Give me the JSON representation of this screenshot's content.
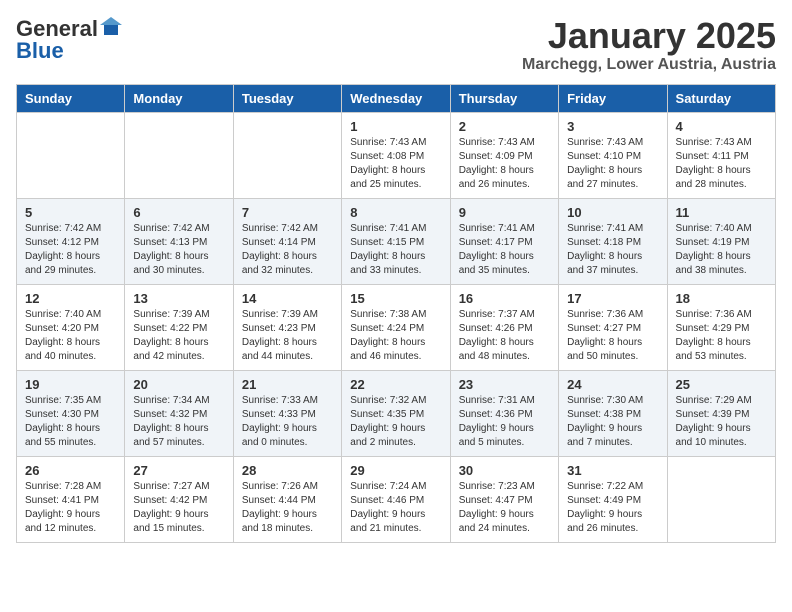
{
  "logo": {
    "general": "General",
    "blue": "Blue"
  },
  "title": "January 2025",
  "location": "Marchegg, Lower Austria, Austria",
  "days_of_week": [
    "Sunday",
    "Monday",
    "Tuesday",
    "Wednesday",
    "Thursday",
    "Friday",
    "Saturday"
  ],
  "weeks": [
    {
      "days": [
        {
          "number": "",
          "info": ""
        },
        {
          "number": "",
          "info": ""
        },
        {
          "number": "",
          "info": ""
        },
        {
          "number": "1",
          "info": "Sunrise: 7:43 AM\nSunset: 4:08 PM\nDaylight: 8 hours and 25 minutes."
        },
        {
          "number": "2",
          "info": "Sunrise: 7:43 AM\nSunset: 4:09 PM\nDaylight: 8 hours and 26 minutes."
        },
        {
          "number": "3",
          "info": "Sunrise: 7:43 AM\nSunset: 4:10 PM\nDaylight: 8 hours and 27 minutes."
        },
        {
          "number": "4",
          "info": "Sunrise: 7:43 AM\nSunset: 4:11 PM\nDaylight: 8 hours and 28 minutes."
        }
      ]
    },
    {
      "days": [
        {
          "number": "5",
          "info": "Sunrise: 7:42 AM\nSunset: 4:12 PM\nDaylight: 8 hours and 29 minutes."
        },
        {
          "number": "6",
          "info": "Sunrise: 7:42 AM\nSunset: 4:13 PM\nDaylight: 8 hours and 30 minutes."
        },
        {
          "number": "7",
          "info": "Sunrise: 7:42 AM\nSunset: 4:14 PM\nDaylight: 8 hours and 32 minutes."
        },
        {
          "number": "8",
          "info": "Sunrise: 7:41 AM\nSunset: 4:15 PM\nDaylight: 8 hours and 33 minutes."
        },
        {
          "number": "9",
          "info": "Sunrise: 7:41 AM\nSunset: 4:17 PM\nDaylight: 8 hours and 35 minutes."
        },
        {
          "number": "10",
          "info": "Sunrise: 7:41 AM\nSunset: 4:18 PM\nDaylight: 8 hours and 37 minutes."
        },
        {
          "number": "11",
          "info": "Sunrise: 7:40 AM\nSunset: 4:19 PM\nDaylight: 8 hours and 38 minutes."
        }
      ]
    },
    {
      "days": [
        {
          "number": "12",
          "info": "Sunrise: 7:40 AM\nSunset: 4:20 PM\nDaylight: 8 hours and 40 minutes."
        },
        {
          "number": "13",
          "info": "Sunrise: 7:39 AM\nSunset: 4:22 PM\nDaylight: 8 hours and 42 minutes."
        },
        {
          "number": "14",
          "info": "Sunrise: 7:39 AM\nSunset: 4:23 PM\nDaylight: 8 hours and 44 minutes."
        },
        {
          "number": "15",
          "info": "Sunrise: 7:38 AM\nSunset: 4:24 PM\nDaylight: 8 hours and 46 minutes."
        },
        {
          "number": "16",
          "info": "Sunrise: 7:37 AM\nSunset: 4:26 PM\nDaylight: 8 hours and 48 minutes."
        },
        {
          "number": "17",
          "info": "Sunrise: 7:36 AM\nSunset: 4:27 PM\nDaylight: 8 hours and 50 minutes."
        },
        {
          "number": "18",
          "info": "Sunrise: 7:36 AM\nSunset: 4:29 PM\nDaylight: 8 hours and 53 minutes."
        }
      ]
    },
    {
      "days": [
        {
          "number": "19",
          "info": "Sunrise: 7:35 AM\nSunset: 4:30 PM\nDaylight: 8 hours and 55 minutes."
        },
        {
          "number": "20",
          "info": "Sunrise: 7:34 AM\nSunset: 4:32 PM\nDaylight: 8 hours and 57 minutes."
        },
        {
          "number": "21",
          "info": "Sunrise: 7:33 AM\nSunset: 4:33 PM\nDaylight: 9 hours and 0 minutes."
        },
        {
          "number": "22",
          "info": "Sunrise: 7:32 AM\nSunset: 4:35 PM\nDaylight: 9 hours and 2 minutes."
        },
        {
          "number": "23",
          "info": "Sunrise: 7:31 AM\nSunset: 4:36 PM\nDaylight: 9 hours and 5 minutes."
        },
        {
          "number": "24",
          "info": "Sunrise: 7:30 AM\nSunset: 4:38 PM\nDaylight: 9 hours and 7 minutes."
        },
        {
          "number": "25",
          "info": "Sunrise: 7:29 AM\nSunset: 4:39 PM\nDaylight: 9 hours and 10 minutes."
        }
      ]
    },
    {
      "days": [
        {
          "number": "26",
          "info": "Sunrise: 7:28 AM\nSunset: 4:41 PM\nDaylight: 9 hours and 12 minutes."
        },
        {
          "number": "27",
          "info": "Sunrise: 7:27 AM\nSunset: 4:42 PM\nDaylight: 9 hours and 15 minutes."
        },
        {
          "number": "28",
          "info": "Sunrise: 7:26 AM\nSunset: 4:44 PM\nDaylight: 9 hours and 18 minutes."
        },
        {
          "number": "29",
          "info": "Sunrise: 7:24 AM\nSunset: 4:46 PM\nDaylight: 9 hours and 21 minutes."
        },
        {
          "number": "30",
          "info": "Sunrise: 7:23 AM\nSunset: 4:47 PM\nDaylight: 9 hours and 24 minutes."
        },
        {
          "number": "31",
          "info": "Sunrise: 7:22 AM\nSunset: 4:49 PM\nDaylight: 9 hours and 26 minutes."
        },
        {
          "number": "",
          "info": ""
        }
      ]
    }
  ]
}
